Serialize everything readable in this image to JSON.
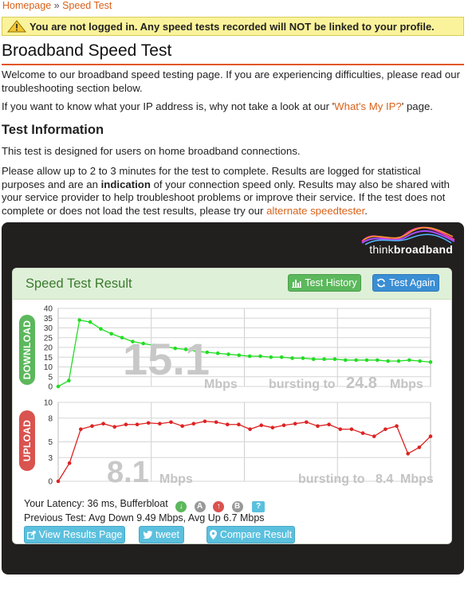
{
  "breadcrumb": {
    "home": "Homepage",
    "sep": "»",
    "current": "Speed Test"
  },
  "warning": "You are not logged in. Any speed tests recorded will NOT be linked to your profile.",
  "page_title": "Broadband Speed Test",
  "intro1": "Welcome to our broadband speed testing page. If you are experiencing difficulties, please read our troubleshooting section below.",
  "intro2": {
    "before": "If you want to know what your IP address is, why not take a look at our '",
    "link": "What's My IP?",
    "after": "' page."
  },
  "section_title": "Test Information",
  "info1": "This test is designed for users on home broadband connections.",
  "info2": {
    "part1": "Please allow up to 2 to 3 minutes for the test to complete. Results are logged for statistical purposes and are an ",
    "bold": "indication",
    "part2": " of your connection speed only. Results may also be shared with your service provider to help troubleshoot problems or improve their service. If the test does not complete or does not load the test results, please try our ",
    "link": "alternate speedtester",
    "part3": "."
  },
  "logo": {
    "think": "think",
    "broadband": "broadband"
  },
  "result": {
    "title": "Speed Test Result",
    "history_btn": "Test History",
    "again_btn": "Test Again"
  },
  "download": {
    "label": "DOWNLOAD",
    "speed": "15.1",
    "unit": "Mbps",
    "burst_label": "bursting to",
    "burst_value": "24.8",
    "burst_unit": "Mbps"
  },
  "upload": {
    "label": "UPLOAD",
    "speed": "8.1",
    "unit": "Mbps",
    "burst_label": "bursting to",
    "burst_value": "8.4",
    "burst_unit": "Mbps"
  },
  "chart_data": [
    {
      "type": "line",
      "ylabel": "DOWNLOAD",
      "ylim": [
        0,
        40
      ],
      "yticks": [
        "0",
        "5",
        "10",
        "15",
        "20",
        "25",
        "30",
        "35",
        "40"
      ],
      "grid": true,
      "color": "#22dd22",
      "values": [
        0,
        3,
        34,
        33,
        29.5,
        27,
        25,
        23,
        22,
        21,
        20.5,
        19.5,
        19,
        18,
        17.5,
        17,
        16.5,
        16,
        15.5,
        15.5,
        15,
        15,
        14.5,
        14.5,
        14,
        14,
        14,
        13.5,
        13.5,
        13.5,
        13.5,
        13,
        13,
        13.5,
        13,
        12.5
      ]
    },
    {
      "type": "line",
      "ylabel": "UPLOAD",
      "ylim": [
        0,
        10
      ],
      "yticks": [
        "0",
        "3",
        "5",
        "8",
        "10"
      ],
      "grid": true,
      "color": "#dd2222",
      "values": [
        0,
        2.3,
        6.6,
        7.0,
        7.3,
        6.9,
        7.2,
        7.2,
        7.4,
        7.3,
        7.5,
        7.0,
        7.3,
        7.6,
        7.5,
        7.2,
        7.2,
        6.6,
        7.1,
        6.8,
        7.1,
        7.3,
        7.5,
        7.0,
        7.2,
        6.6,
        6.6,
        6.1,
        5.7,
        6.6,
        7.0,
        3.5,
        4.3,
        5.7
      ]
    }
  ],
  "latency": {
    "text": "Your Latency: 36 ms, Bufferbloat",
    "grade_a": "A",
    "grade_b": "B",
    "help": "?"
  },
  "previous": "Previous Test: Avg Down 9.49 Mbps, Avg Up 6.7 Mbps",
  "actions": {
    "view": "View Results Page",
    "tweet": "tweet",
    "compare": "Compare Result"
  }
}
